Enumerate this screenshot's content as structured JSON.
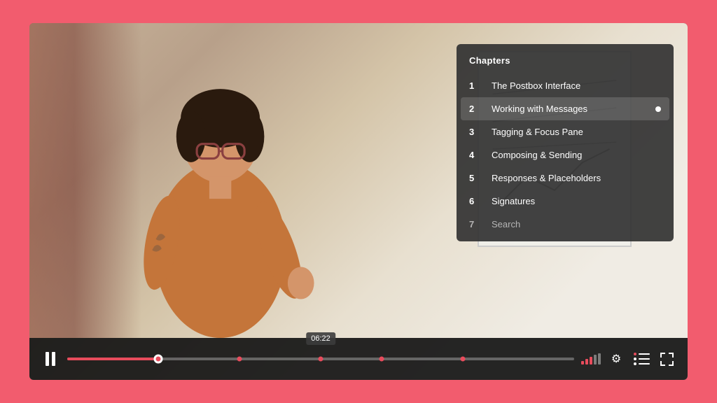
{
  "video": {
    "current_time": "06:22",
    "progress_percent": 18
  },
  "chapters": {
    "title": "Chapters",
    "items": [
      {
        "num": "1",
        "label": "The Postbox Interface",
        "active": false
      },
      {
        "num": "2",
        "label": "Working with Messages",
        "active": true
      },
      {
        "num": "3",
        "label": "Tagging & Focus Pane",
        "active": false
      },
      {
        "num": "4",
        "label": "Composing & Sending",
        "active": false
      },
      {
        "num": "5",
        "label": "Responses & Placeholders",
        "active": false
      },
      {
        "num": "6",
        "label": "Signatures",
        "active": false
      },
      {
        "num": "7",
        "label": "Search",
        "active": false
      }
    ]
  },
  "controls": {
    "pause_label": "Pause",
    "settings_label": "Settings",
    "chapters_label": "Chapters",
    "fullscreen_label": "Fullscreen"
  },
  "chapter_markers": [
    0.18,
    0.34,
    0.5,
    0.62,
    0.78
  ]
}
